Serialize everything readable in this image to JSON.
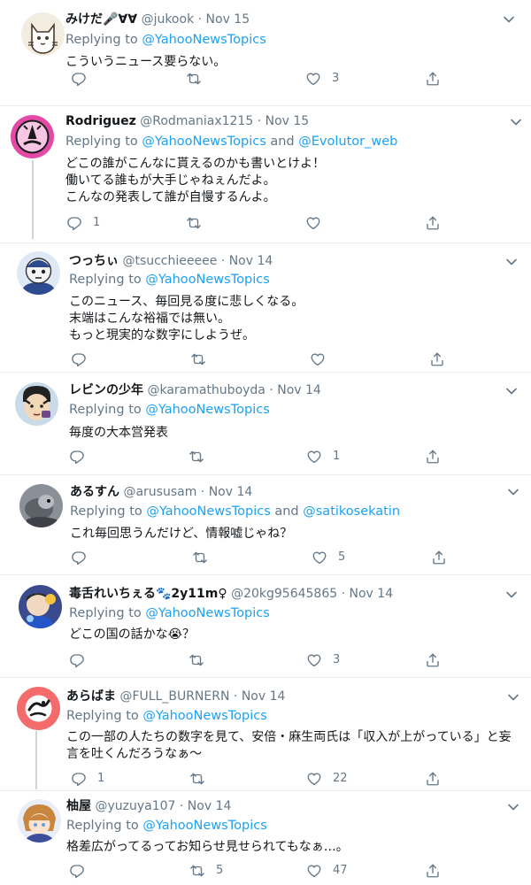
{
  "colors": {
    "accent": "#1da1f2",
    "muted": "#657786",
    "border": "#e6ecf0",
    "thread": "#ccd6dd"
  },
  "tweets": [
    {
      "name": "みけだ🎤∀∀",
      "handle": "@jukook",
      "date": "Nov 15",
      "replying_prefix": "Replying to",
      "mention1": "@YahooNewsTopics",
      "and": "",
      "mention2": "",
      "text": "こういうニュース要らない。",
      "reply_count": "",
      "retweet_count": "",
      "like_count": "3"
    },
    {
      "name": "Rodriguez",
      "handle": "@Rodmaniax1215",
      "date": "Nov 15",
      "replying_prefix": "Replying to",
      "mention1": "@YahooNewsTopics",
      "and": "and",
      "mention2": "@Evolutor_web",
      "text": "どこの誰がこんなに貰えるのかも書いとけよ！\n働いてる誰もが大手じゃねぇんだよ。\nこんなの発表して誰が自慢するんよ。",
      "reply_count": "1",
      "retweet_count": "",
      "like_count": ""
    },
    {
      "name": "つっちぃ",
      "handle": "@tsucchieeeee",
      "date": "Nov 14",
      "replying_prefix": "Replying to",
      "mention1": "@YahooNewsTopics",
      "and": "",
      "mention2": "",
      "text": "このニュース、毎回見る度に悲しくなる。\n末端はこんな裕福では無い。\nもっと現実的な数字にしようぜ。",
      "reply_count": "",
      "retweet_count": "",
      "like_count": ""
    },
    {
      "name": "レビンの少年",
      "handle": "@karamathuboyda",
      "date": "Nov 14",
      "replying_prefix": "Replying to",
      "mention1": "@YahooNewsTopics",
      "and": "",
      "mention2": "",
      "text": "毎度の大本営発表",
      "reply_count": "",
      "retweet_count": "",
      "like_count": "1"
    },
    {
      "name": "あるすん",
      "handle": "@arususam",
      "date": "Nov 14",
      "replying_prefix": "Replying to",
      "mention1": "@YahooNewsTopics",
      "and": "and",
      "mention2": "@satikosekatin",
      "text": "これ毎回思うんだけど、情報嘘じゃね？",
      "reply_count": "",
      "retweet_count": "",
      "like_count": "5"
    },
    {
      "name": "毒舌れいちぇる🐾2y11m♀",
      "handle": "@20kg95645865",
      "date": "Nov 14",
      "replying_prefix": "Replying to",
      "mention1": "@YahooNewsTopics",
      "and": "",
      "mention2": "",
      "text": "どこの国の話かな😭？",
      "reply_count": "",
      "retweet_count": "",
      "like_count": "3"
    },
    {
      "name": "あらばま",
      "handle": "@FULL_BURNERN",
      "date": "Nov 14",
      "replying_prefix": "Replying to",
      "mention1": "@YahooNewsTopics",
      "and": "",
      "mention2": "",
      "text": "この一部の人たちの数字を見て、安倍・麻生両氏は「収入が上がっている」と妄言を吐くんだろうなぁ〜",
      "reply_count": "1",
      "retweet_count": "",
      "like_count": "22"
    },
    {
      "name": "柚屋",
      "handle": "@yuzuya107",
      "date": "Nov 14",
      "replying_prefix": "Replying to",
      "mention1": "@YahooNewsTopics",
      "and": "",
      "mention2": "",
      "text": "格差広がってるってお知らせ見せられてもなぁ…。",
      "reply_count": "",
      "retweet_count": "5",
      "like_count": "47"
    }
  ]
}
